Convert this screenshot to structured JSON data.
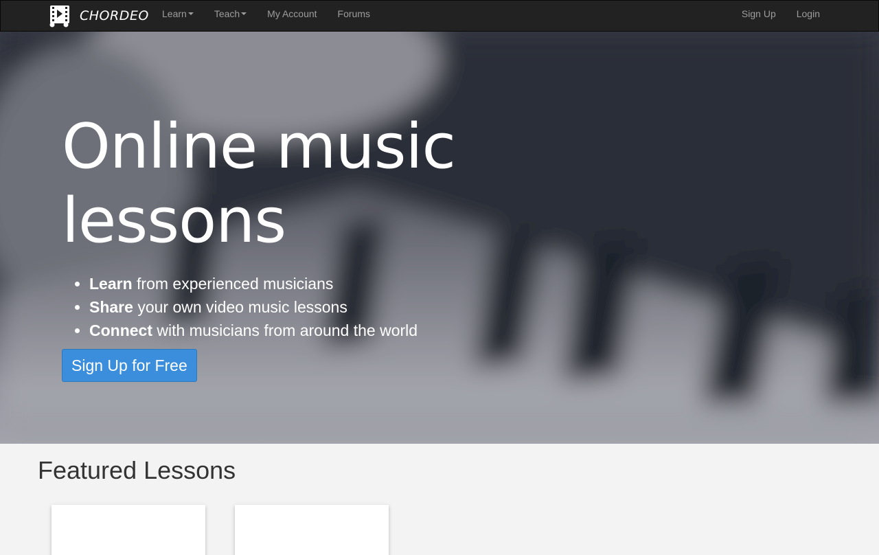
{
  "brand": {
    "name": "CHORDEO"
  },
  "nav": {
    "left": [
      {
        "label": "Learn",
        "dropdown": true
      },
      {
        "label": "Teach",
        "dropdown": true
      },
      {
        "label": "My Account",
        "dropdown": false
      },
      {
        "label": "Forums",
        "dropdown": false
      }
    ],
    "right": [
      {
        "label": "Sign Up"
      },
      {
        "label": "Login"
      }
    ]
  },
  "hero": {
    "title_line1": "Online music",
    "title_line2": "lessons",
    "features": [
      {
        "bold": "Learn",
        "rest": " from experienced musicians"
      },
      {
        "bold": "Share",
        "rest": " your own video music lessons"
      },
      {
        "bold": "Connect",
        "rest": " with musicians from around the world"
      }
    ],
    "cta_label": "Sign Up for Free"
  },
  "featured": {
    "title": "Featured Lessons"
  },
  "colors": {
    "navbar": "#222222",
    "accent": "#3a8edb",
    "page_bg": "#f3f3f3"
  }
}
